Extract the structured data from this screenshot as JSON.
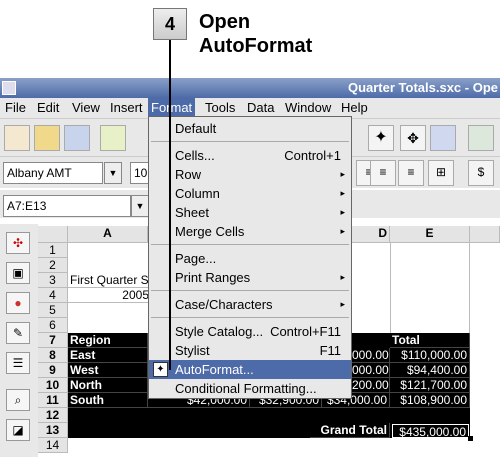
{
  "callout": {
    "number": "4",
    "line1": "Open",
    "line2": "AutoFormat"
  },
  "window": {
    "title": "Quarter Totals.sxc - Ope"
  },
  "menubar": [
    "File",
    "Edit",
    "View",
    "Insert",
    "Format",
    "Tools",
    "Data",
    "Window",
    "Help"
  ],
  "font_name": "Albany AMT",
  "font_size": "10",
  "name_box": "A7:E13",
  "format_menu": {
    "items": [
      {
        "label": "Default",
        "shortcut": "",
        "submenu": false
      },
      {
        "label": "Cells...",
        "shortcut": "Control+1",
        "submenu": false
      },
      {
        "label": "Row",
        "shortcut": "",
        "submenu": true
      },
      {
        "label": "Column",
        "shortcut": "",
        "submenu": true
      },
      {
        "label": "Sheet",
        "shortcut": "",
        "submenu": true
      },
      {
        "label": "Merge Cells",
        "shortcut": "",
        "submenu": true
      },
      {
        "label": "Page...",
        "shortcut": "",
        "submenu": false
      },
      {
        "label": "Print Ranges",
        "shortcut": "",
        "submenu": true
      },
      {
        "label": "Case/Characters",
        "shortcut": "",
        "submenu": true
      },
      {
        "label": "Style Catalog...",
        "shortcut": "Control+F11",
        "submenu": false
      },
      {
        "label": "Stylist",
        "shortcut": "F11",
        "submenu": false
      },
      {
        "label": "AutoFormat...",
        "shortcut": "",
        "submenu": false,
        "highlighted": true
      },
      {
        "label": "Conditional Formatting...",
        "shortcut": "",
        "submenu": false
      }
    ]
  },
  "sheet": {
    "columns": [
      "A",
      "D",
      "E"
    ],
    "row_numbers": [
      "1",
      "2",
      "3",
      "4",
      "5",
      "6",
      "7",
      "8",
      "9",
      "10",
      "11",
      "12",
      "13",
      "14"
    ],
    "a3": "First Quarter S",
    "a4": "2005",
    "header_row": {
      "region": "Region",
      "total": "Total"
    },
    "rows": [
      {
        "region": "East",
        "b": "",
        "c": "",
        "d": "000.00",
        "total": "$110,000.00"
      },
      {
        "region": "West",
        "b": "",
        "c": "",
        "d": "000.00",
        "total": "$94,400.00"
      },
      {
        "region": "North",
        "b": "",
        "c": "",
        "d": "200.00",
        "total": "$121,700.00"
      },
      {
        "region": "South",
        "b": "$42,000.00",
        "c": "$32,900.00",
        "d": "$34,000.00",
        "total": "$108,900.00"
      }
    ],
    "grand_total_label": "Grand Total",
    "grand_total_value": "$435,000.00"
  }
}
